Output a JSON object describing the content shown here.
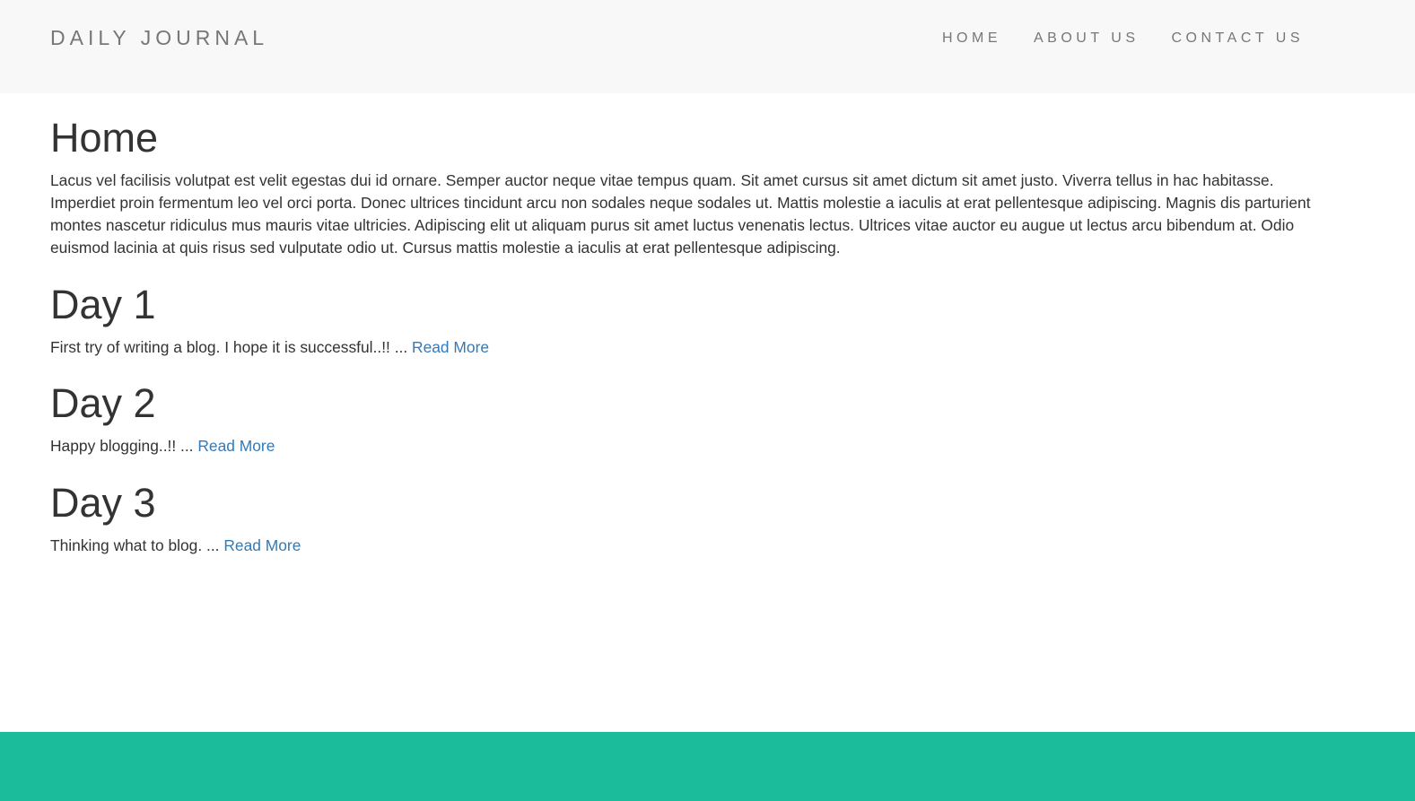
{
  "navbar": {
    "brand": "DAILY JOURNAL",
    "links": [
      {
        "label": "HOME"
      },
      {
        "label": "ABOUT US"
      },
      {
        "label": "CONTACT US"
      }
    ]
  },
  "main": {
    "title": "Home",
    "intro": "Lacus vel facilisis volutpat est velit egestas dui id ornare. Semper auctor neque vitae tempus quam. Sit amet cursus sit amet dictum sit amet justo. Viverra tellus in hac habitasse. Imperdiet proin fermentum leo vel orci porta. Donec ultrices tincidunt arcu non sodales neque sodales ut. Mattis molestie a iaculis at erat pellentesque adipiscing. Magnis dis parturient montes nascetur ridiculus mus mauris vitae ultricies. Adipiscing elit ut aliquam purus sit amet luctus venenatis lectus. Ultrices vitae auctor eu augue ut lectus arcu bibendum at. Odio euismod lacinia at quis risus sed vulputate odio ut. Cursus mattis molestie a iaculis at erat pellentesque adipiscing.",
    "posts": [
      {
        "title": "Day 1",
        "excerpt": "First try of writing a blog. I hope it is successful..!! ... ",
        "link": "Read More"
      },
      {
        "title": "Day 2",
        "excerpt": "Happy blogging..!! ... ",
        "link": "Read More"
      },
      {
        "title": "Day 3",
        "excerpt": "Thinking what to blog. ... ",
        "link": "Read More"
      }
    ]
  },
  "colors": {
    "navbar_bg": "#f8f8f8",
    "nav_text": "#777777",
    "body_text": "#333333",
    "link": "#337ab7",
    "footer_bg": "#1abc9c"
  }
}
